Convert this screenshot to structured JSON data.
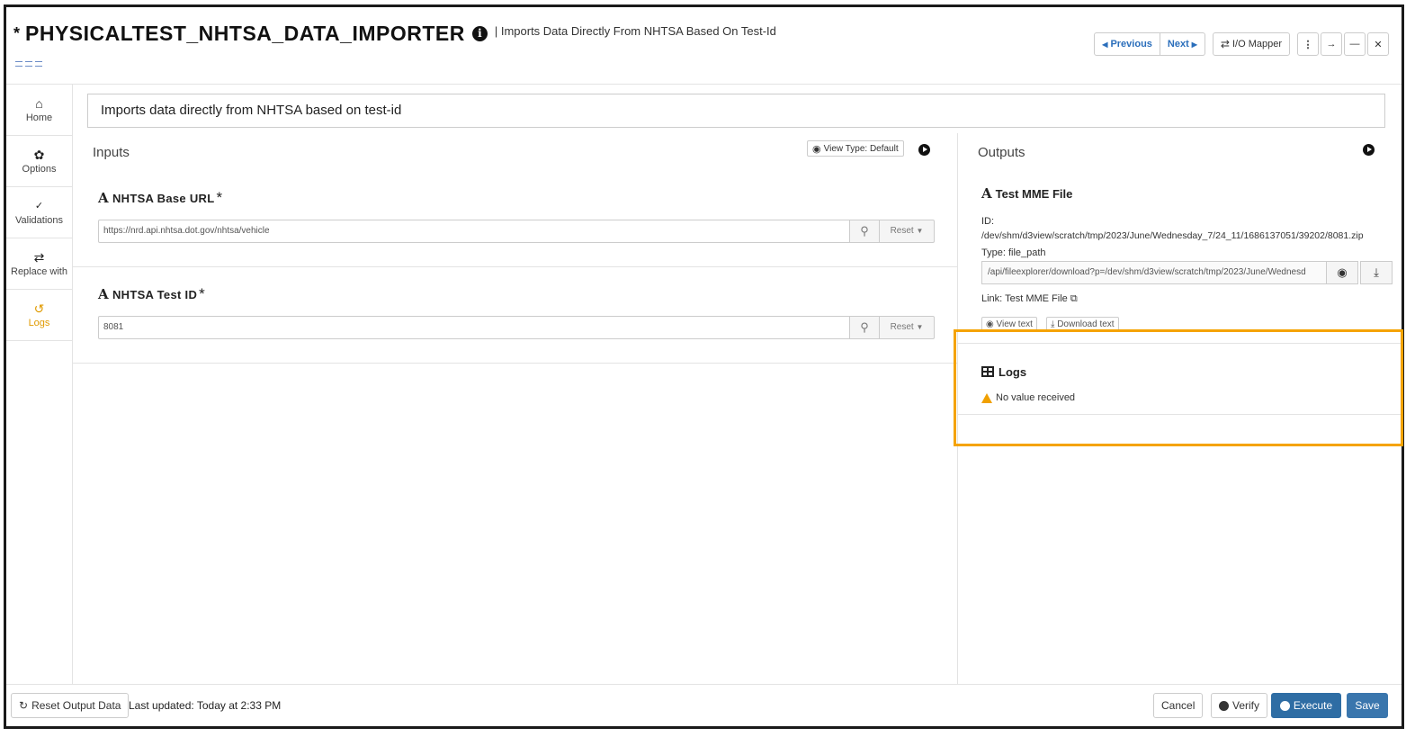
{
  "header": {
    "modified_marker": "*",
    "title": "PHYSICALTEST_NHTSA_DATA_IMPORTER",
    "subtitle": "| Imports Data Directly From NHTSA Based On Test-Id",
    "previous_label": "Previous",
    "next_label": "Next",
    "io_mapper_label": "I/O Mapper"
  },
  "sidebar": {
    "items": [
      {
        "label": "Home",
        "icon": "home-icon"
      },
      {
        "label": "Options",
        "icon": "gear-icon"
      },
      {
        "label": "Validations",
        "icon": "check-icon"
      },
      {
        "label": "Replace with",
        "icon": "swap-icon"
      },
      {
        "label": "Logs",
        "icon": "history-icon"
      }
    ]
  },
  "description": "Imports data directly from NHTSA based on test-id",
  "inputs": {
    "title": "Inputs",
    "view_type_label": "View Type: Default",
    "fields": [
      {
        "label": "NHTSA Base URL",
        "required": "*",
        "value": "https://nrd.api.nhtsa.dot.gov/nhtsa/vehicle",
        "reset_label": "Reset"
      },
      {
        "label": "NHTSA Test ID",
        "required": "*",
        "value": "8081",
        "reset_label": "Reset"
      }
    ]
  },
  "outputs": {
    "title": "Outputs",
    "file": {
      "label": "Test MME File",
      "id_label": "ID:",
      "id_value": "/dev/shm/d3view/scratch/tmp/2023/June/Wednesday_7/24_11/1686137051/39202/8081.zip",
      "type_text": "Type: file_path",
      "link_value": "/api/fileexplorer/download?p=/dev/shm/d3view/scratch/tmp/2023/June/Wednesd",
      "link_text": "Link: Test MME File",
      "view_text_label": "View text",
      "download_text_label": "Download text"
    },
    "logs": {
      "label": "Logs",
      "message": "No value received"
    }
  },
  "footer": {
    "reset_output_label": "Reset Output Data",
    "last_updated": "Last updated: Today at 2:33 PM",
    "cancel_label": "Cancel",
    "verify_label": "Verify",
    "execute_label": "Execute",
    "save_label": "Save"
  },
  "colors": {
    "accent": "#2e6da4",
    "highlight": "#f5a300",
    "active_nav": "#e09a00"
  }
}
